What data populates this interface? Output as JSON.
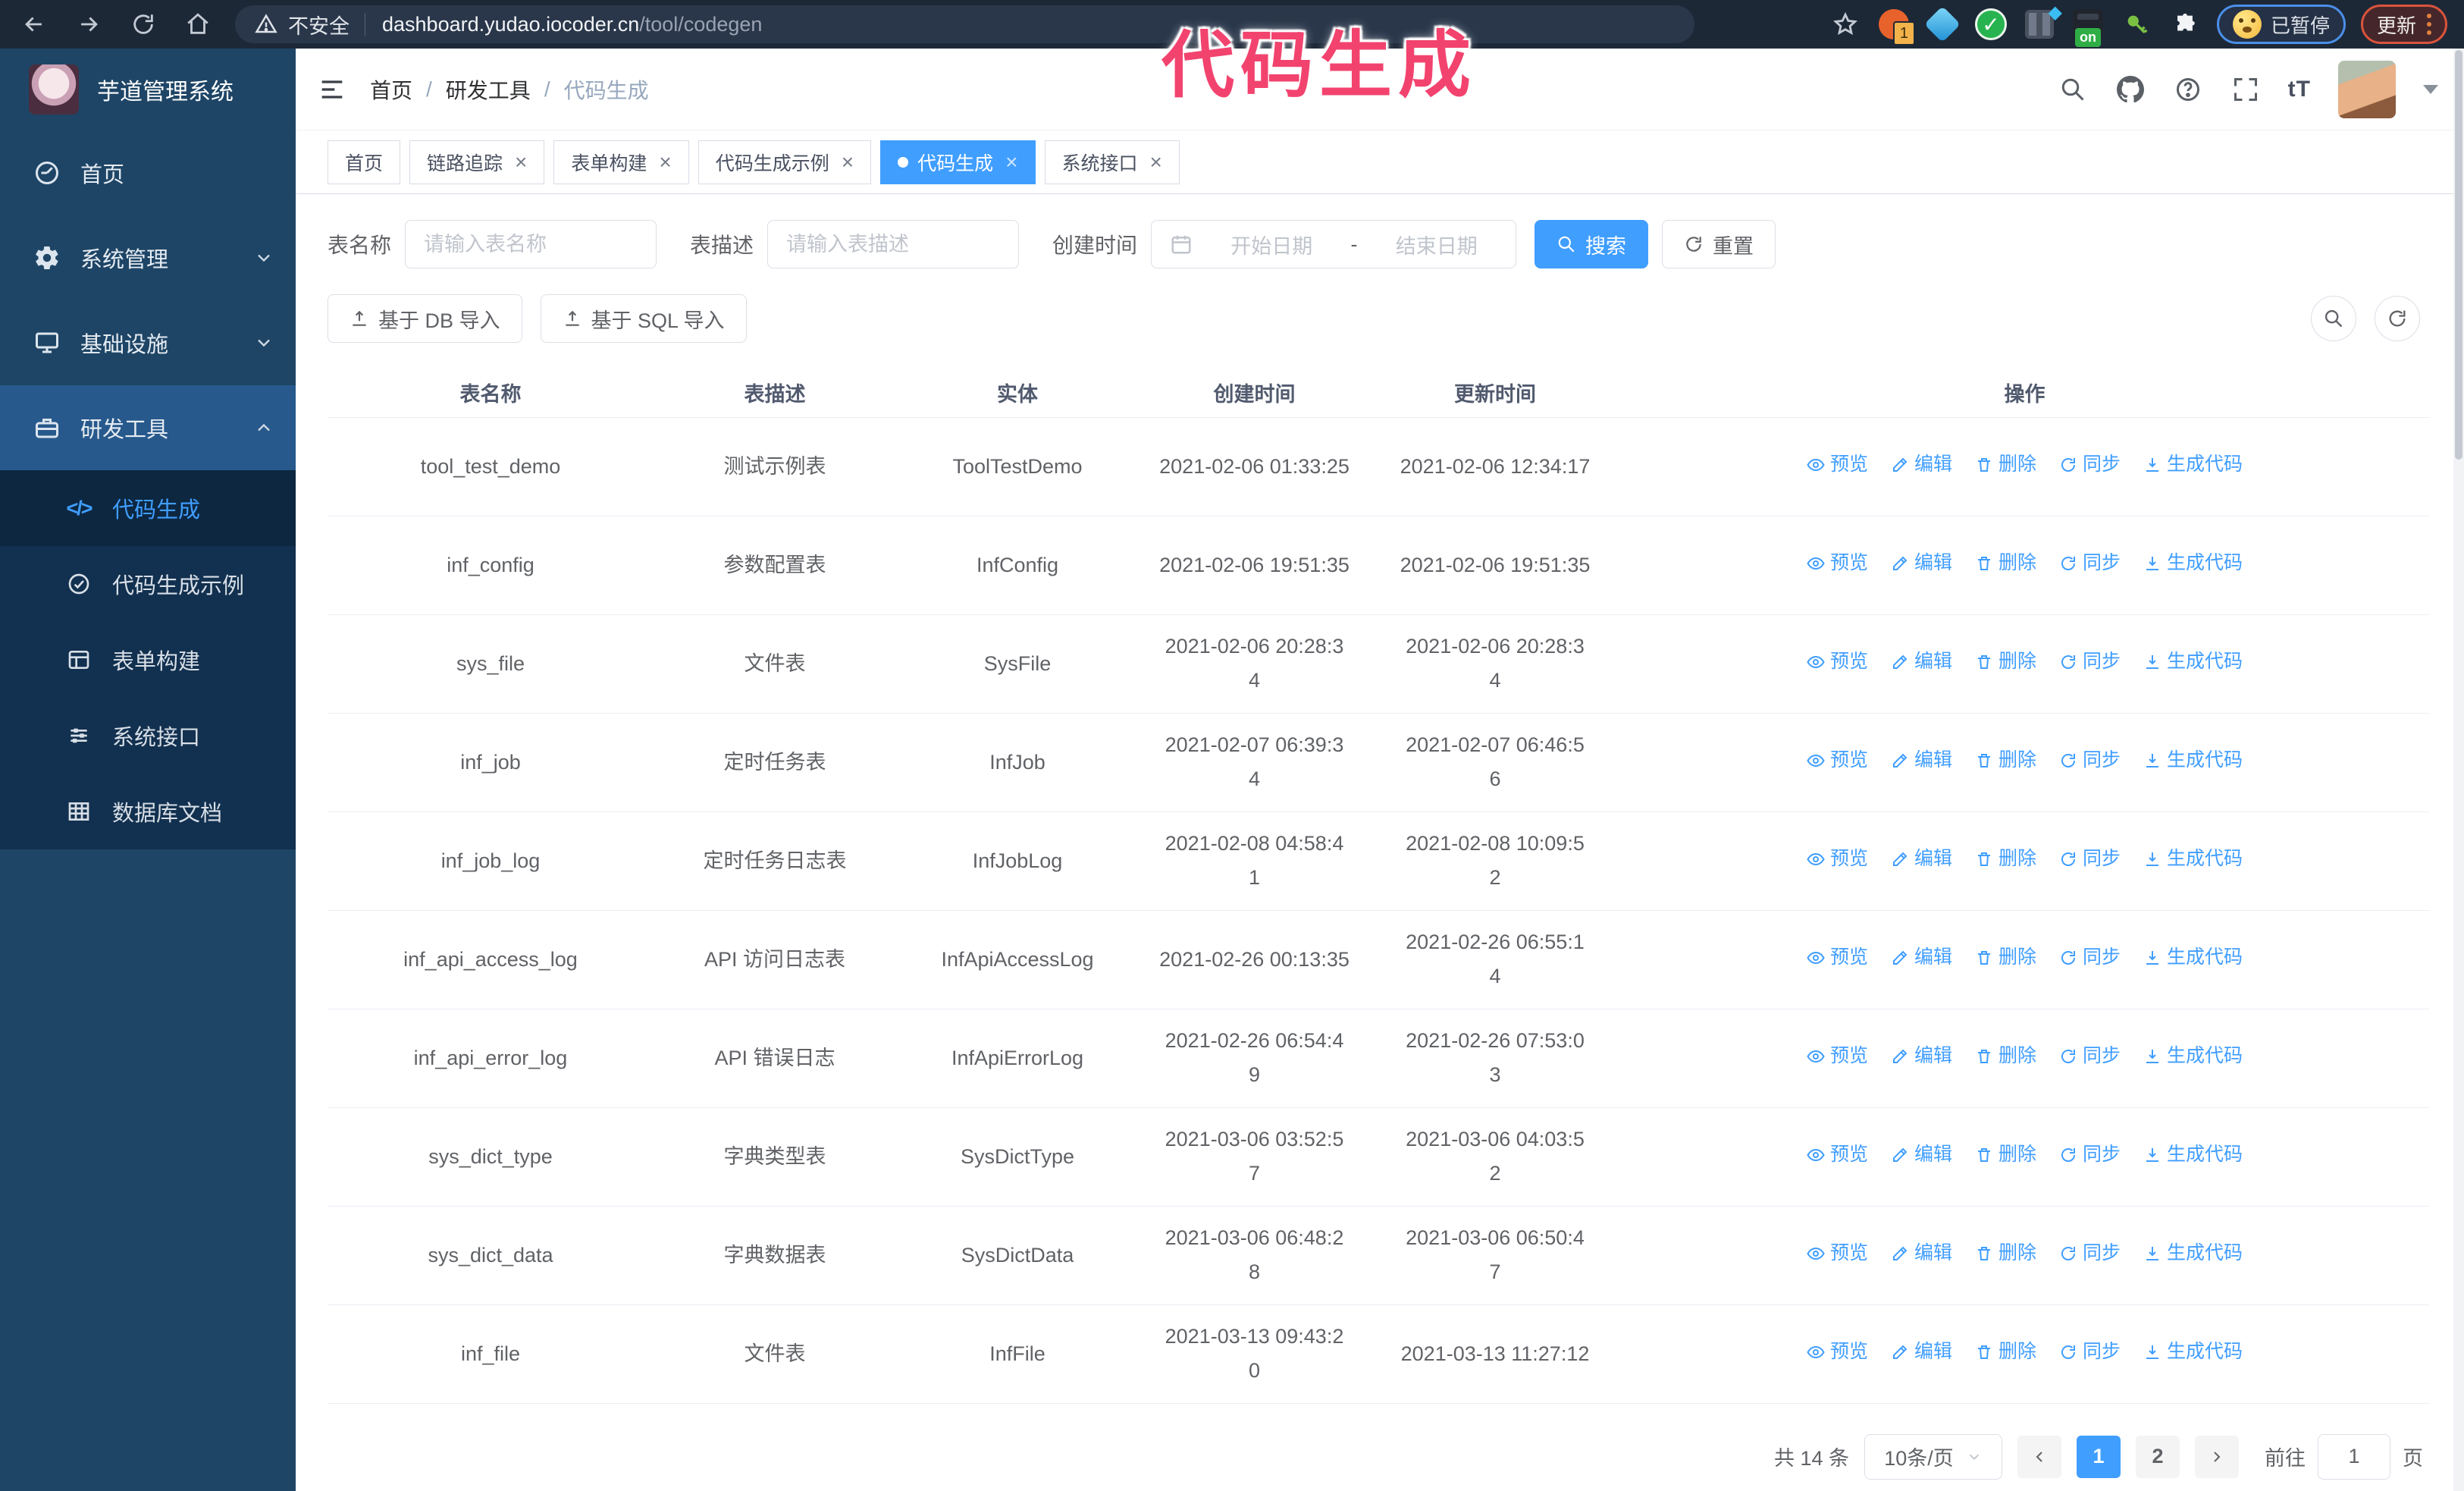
{
  "browser": {
    "security_label": "不安全",
    "url_host": "dashboard.yudao.iocoder.cn",
    "url_path": "/tool/codegen",
    "ext_badge": "1",
    "ext_on": "on",
    "paused_label": "已暂停",
    "update_label": "更新",
    "icons": [
      "back-icon",
      "forward-icon",
      "reload-icon",
      "home-icon",
      "warning-icon",
      "star-icon",
      "adblock-extension-icon",
      "gem-extension-icon",
      "check-extension-icon",
      "columns-extension-icon",
      "onetab-extension-icon",
      "key-extension-icon",
      "puzzle-extensions-icon"
    ]
  },
  "watermark": "代码生成",
  "app": {
    "title": "芋道管理系统",
    "breadcrumb": [
      "首页",
      "研发工具",
      "代码生成"
    ],
    "breadcrumb_separator": "/",
    "header_icons": [
      "search-icon",
      "github-icon",
      "help-icon",
      "fullscreen-icon",
      "text-size-icon",
      "avatar",
      "dropdown-caret"
    ]
  },
  "sidebar": {
    "items": [
      {
        "key": "home",
        "label": "首页",
        "icon": "dashboard"
      },
      {
        "key": "system",
        "label": "系统管理",
        "icon": "gear",
        "chevron": "down"
      },
      {
        "key": "infra",
        "label": "基础设施",
        "icon": "monitor",
        "chevron": "down"
      },
      {
        "key": "devtools",
        "label": "研发工具",
        "icon": "toolbox",
        "chevron": "up",
        "highlight": true
      }
    ],
    "submenu": [
      {
        "key": "codegen",
        "label": "代码生成",
        "icon": "code",
        "active": true
      },
      {
        "key": "codegen-example",
        "label": "代码生成示例",
        "icon": "example"
      },
      {
        "key": "form-builder",
        "label": "表单构建",
        "icon": "form"
      },
      {
        "key": "system-api",
        "label": "系统接口",
        "icon": "api"
      },
      {
        "key": "db-doc",
        "label": "数据库文档",
        "icon": "dbdoc"
      }
    ]
  },
  "tabs": [
    {
      "key": "home",
      "label": "首页",
      "closable": false,
      "active": false
    },
    {
      "key": "tracing",
      "label": "链路追踪",
      "closable": true,
      "active": false
    },
    {
      "key": "form-builder",
      "label": "表单构建",
      "closable": true,
      "active": false
    },
    {
      "key": "codegen-example",
      "label": "代码生成示例",
      "closable": true,
      "active": false
    },
    {
      "key": "codegen",
      "label": "代码生成",
      "closable": true,
      "active": true
    },
    {
      "key": "system-api",
      "label": "系统接口",
      "closable": true,
      "active": false
    }
  ],
  "search": {
    "name_label": "表名称",
    "name_placeholder": "请输入表名称",
    "desc_label": "表描述",
    "desc_placeholder": "请输入表描述",
    "time_label": "创建时间",
    "start_placeholder": "开始日期",
    "range_separator": "-",
    "end_placeholder": "结束日期",
    "search_button": "搜索",
    "reset_button": "重置"
  },
  "toolbar": {
    "db_import": "基于 DB 导入",
    "sql_import": "基于 SQL 导入"
  },
  "table": {
    "headers": [
      "表名称",
      "表描述",
      "实体",
      "创建时间",
      "更新时间",
      "操作"
    ],
    "actions": [
      "预览",
      "编辑",
      "删除",
      "同步",
      "生成代码"
    ],
    "action_keys": [
      "preview",
      "edit",
      "delete",
      "sync",
      "generate"
    ],
    "rows": [
      {
        "name": "tool_test_demo",
        "desc": "测试示例表",
        "entity": "ToolTestDemo",
        "created": "2021-02-06 01:33:25",
        "updated": "2021-02-06 12:34:17"
      },
      {
        "name": "inf_config",
        "desc": "参数配置表",
        "entity": "InfConfig",
        "created": "2021-02-06 19:51:35",
        "updated": "2021-02-06 19:51:35"
      },
      {
        "name": "sys_file",
        "desc": "文件表",
        "entity": "SysFile",
        "created": "2021-02-06 20:28:3\n4",
        "updated": "2021-02-06 20:28:3\n4"
      },
      {
        "name": "inf_job",
        "desc": "定时任务表",
        "entity": "InfJob",
        "created": "2021-02-07 06:39:3\n4",
        "updated": "2021-02-07 06:46:5\n6"
      },
      {
        "name": "inf_job_log",
        "desc": "定时任务日志表",
        "entity": "InfJobLog",
        "created": "2021-02-08 04:58:4\n1",
        "updated": "2021-02-08 10:09:5\n2"
      },
      {
        "name": "inf_api_access_log",
        "desc": "API 访问日志表",
        "entity": "InfApiAccessLog",
        "created": "2021-02-26 00:13:35",
        "updated": "2021-02-26 06:55:1\n4"
      },
      {
        "name": "inf_api_error_log",
        "desc": "API 错误日志",
        "entity": "InfApiErrorLog",
        "created": "2021-02-26 06:54:4\n9",
        "updated": "2021-02-26 07:53:0\n3"
      },
      {
        "name": "sys_dict_type",
        "desc": "字典类型表",
        "entity": "SysDictType",
        "created": "2021-03-06 03:52:5\n7",
        "updated": "2021-03-06 04:03:5\n2"
      },
      {
        "name": "sys_dict_data",
        "desc": "字典数据表",
        "entity": "SysDictData",
        "created": "2021-03-06 06:48:2\n8",
        "updated": "2021-03-06 06:50:4\n7"
      },
      {
        "name": "inf_file",
        "desc": "文件表",
        "entity": "InfFile",
        "created": "2021-03-13 09:43:2\n0",
        "updated": "2021-03-13 11:27:12"
      }
    ]
  },
  "pagination": {
    "total": "共 14 条",
    "page_size": "10条/页",
    "pages": [
      "1",
      "2"
    ],
    "active_page": "1",
    "goto_label": "前往",
    "goto_value": "1",
    "page_label": "页"
  },
  "colors": {
    "accent": "#409eff",
    "watermark_pink": "#f2436e",
    "sidebar_bg": "#1e4566",
    "submenu_bg": "#12304f",
    "topbar_bg": "#1d2837"
  }
}
